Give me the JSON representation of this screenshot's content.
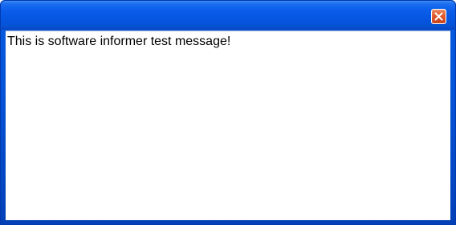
{
  "window": {
    "title": "",
    "close_icon": "close-icon",
    "colors": {
      "titlebar": "#0654d8",
      "frame": "#0340b8",
      "close_button": "#e0582c",
      "client_background": "#ffffff",
      "text": "#000000"
    }
  },
  "content": {
    "message": "This is software informer test message!"
  }
}
